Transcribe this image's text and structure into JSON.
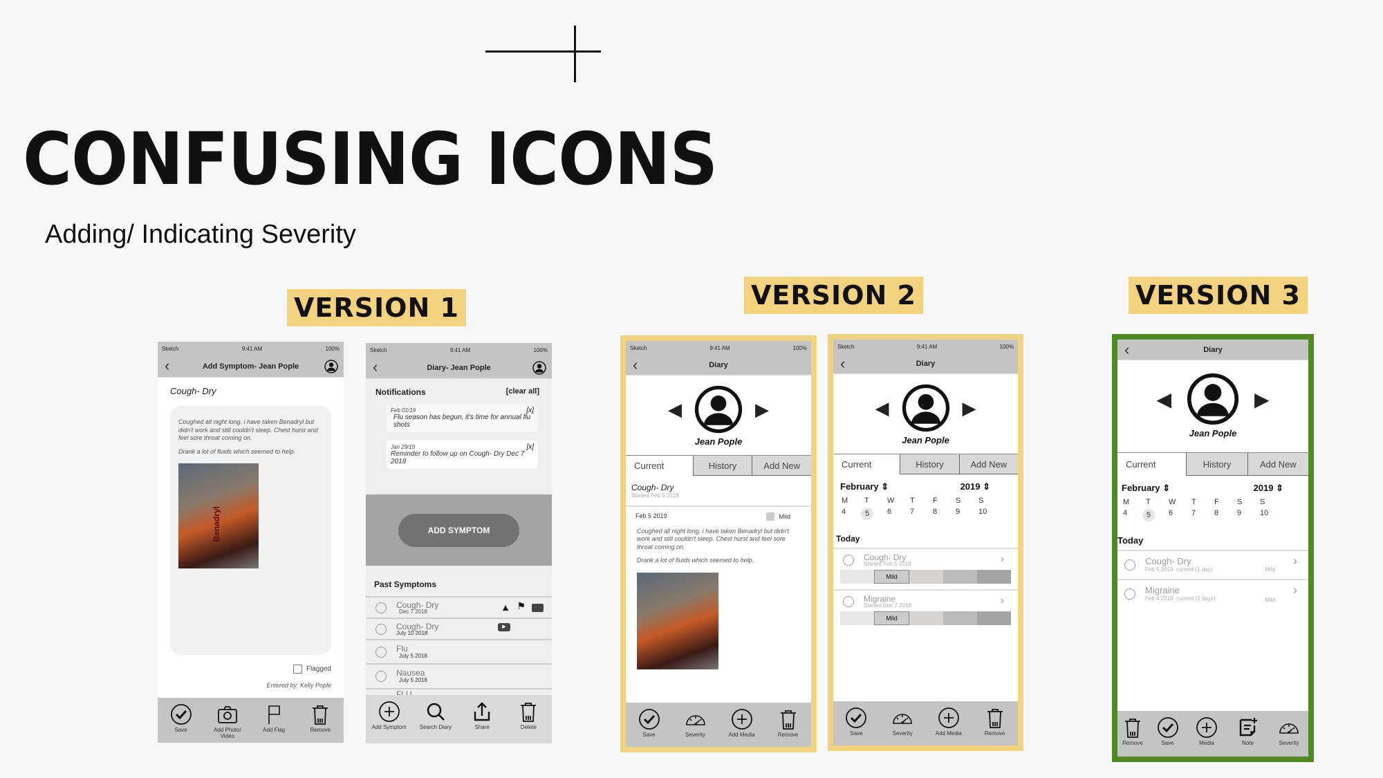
{
  "slide": {
    "title": "CONFUSING ICONS",
    "subtitle": "Adding/ Indicating Severity",
    "accent_color": "#f2d27e",
    "selected_color": "#4f8a22"
  },
  "versions": [
    {
      "label": "VERSION 1"
    },
    {
      "label": "VERSION 2"
    },
    {
      "label": "VERSION 3"
    }
  ],
  "status_bar": {
    "carrier": "Sketch",
    "time": "9:41 AM",
    "battery": "100%"
  },
  "v1_add_symptom": {
    "nav_title": "Add Symptom- Jean Pople",
    "symptom": "Cough- Dry",
    "note_p1": "Coughed all night long. i have taken Benadryl but didn't work and still couldn't sleep. Chest hurst and feel sore throat coming on.",
    "note_p2": "Drank a lot of fluids which seemed to help.",
    "photo_label": "Benadryl",
    "flagged_label": "Flagged",
    "entered_by": "Entered by: Kelly Pople",
    "toolbar": [
      {
        "icon": "check-circle-icon",
        "label": "Save"
      },
      {
        "icon": "camera-icon",
        "label": "Add Photo/ Video"
      },
      {
        "icon": "flag-icon",
        "label": "Add Flag"
      },
      {
        "icon": "trash-icon",
        "label": "Remove"
      }
    ]
  },
  "v1_diary": {
    "nav_title": "Diary- Jean Pople",
    "notifications_title": "Notifications",
    "clear_all": "[clear all]",
    "notifications": [
      {
        "date": "Feb 01/19",
        "close": "[x]",
        "text": "Flu season has begun, it's time for annual flu shots"
      },
      {
        "date": "Jan 29/19",
        "close": "[x]",
        "text": "Reminder to follow up on Cough- Dry Dec 7 2018"
      }
    ],
    "add_symptom_button": "ADD SYMPTOM",
    "past_symptoms_title": "Past Symptoms",
    "past_symptoms": [
      {
        "name": "Cough- Dry",
        "date": "Dec 7 2018",
        "icons": [
          "warning-icon",
          "flag-icon",
          "image-icon"
        ]
      },
      {
        "name": "Cough- Dry",
        "date": "July 10 2018",
        "icons": [
          "video-icon"
        ]
      },
      {
        "name": "Flu",
        "date": "July 5 2018",
        "icons": []
      },
      {
        "name": "Nausea",
        "date": "July 5 2018",
        "icons": []
      },
      {
        "name": "FLU",
        "date": "",
        "icons": []
      }
    ],
    "toolbar": [
      {
        "icon": "add-circle-icon",
        "label": "Add Symptom"
      },
      {
        "icon": "search-icon",
        "label": "Search Diary"
      },
      {
        "icon": "share-icon",
        "label": "Share"
      },
      {
        "icon": "trash-icon",
        "label": "Delete"
      }
    ]
  },
  "diary_common": {
    "nav_title": "Diary",
    "user_name": "Jean Pople",
    "tabs": [
      "Current",
      "History",
      "Add New"
    ]
  },
  "v2_detail": {
    "symptom": "Cough- Dry",
    "started": "Started Feb 5 2019",
    "entry_date": "Feb 5 2019",
    "severity_label": "Mild",
    "note_p1": "Coughed all night long. i have taken Benadryl but didn't work and still couldn't sleep. Chest hurst and feel sore throat coming on.",
    "note_p2": "Drank a lot of fluids which seemed to help.",
    "toolbar": [
      {
        "icon": "check-circle-icon",
        "label": "Save"
      },
      {
        "icon": "gauge-icon",
        "label": "Severity"
      },
      {
        "icon": "add-circle-icon",
        "label": "Add Media"
      },
      {
        "icon": "trash-icon",
        "label": "Remove"
      }
    ]
  },
  "calendar": {
    "month": "February",
    "year": "2019",
    "weekdays": [
      "M",
      "T",
      "W",
      "T",
      "F",
      "S",
      "S"
    ],
    "days": [
      "4",
      "5",
      "6",
      "7",
      "8",
      "9",
      "10"
    ],
    "selected_day": "5",
    "today_label": "Today"
  },
  "v2_list": {
    "items": [
      {
        "name": "Cough- Dry",
        "sub": "Started Feb 5 2019",
        "severity": "Mild",
        "severity_level": 2,
        "severity_levels": 5
      },
      {
        "name": "Migraine",
        "sub": "Started Dec 7 2018",
        "severity": "Mild",
        "severity_level": 2,
        "severity_levels": 5
      }
    ],
    "toolbar": [
      {
        "icon": "check-circle-icon",
        "label": "Save"
      },
      {
        "icon": "gauge-icon",
        "label": "Severity"
      },
      {
        "icon": "add-circle-icon",
        "label": "Add Media"
      },
      {
        "icon": "trash-icon",
        "label": "Remove"
      }
    ]
  },
  "v3_list": {
    "items": [
      {
        "name": "Cough- Dry",
        "sub": "Feb 5 2019- current (1 day)",
        "severity": "Mild"
      },
      {
        "name": "Migraine",
        "sub": "Feb 4 2019- current (2 days)",
        "severity": "Mild"
      }
    ],
    "toolbar": [
      {
        "icon": "trash-icon",
        "label": "Remove"
      },
      {
        "icon": "check-circle-icon",
        "label": "Save"
      },
      {
        "icon": "add-circle-icon",
        "label": "Media"
      },
      {
        "icon": "note-add-icon",
        "label": "Note"
      },
      {
        "icon": "gauge-icon",
        "label": "Severity"
      }
    ]
  }
}
